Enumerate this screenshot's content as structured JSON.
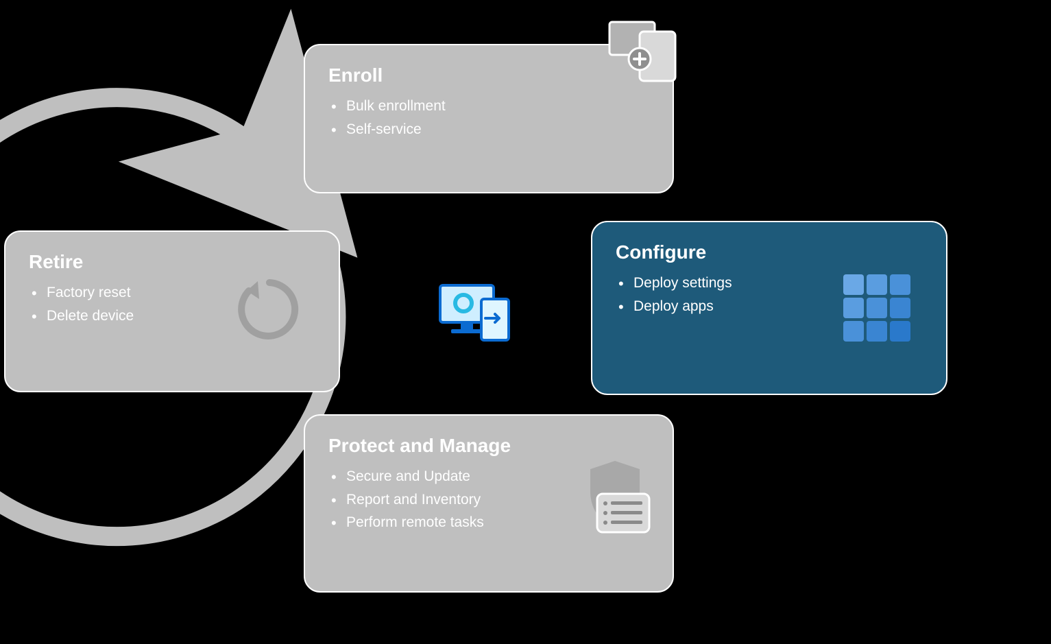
{
  "cycle": {
    "enroll": {
      "title": "Enroll",
      "items": [
        "Bulk enrollment",
        "Self-service"
      ],
      "icon": "devices-add-icon",
      "active": false
    },
    "configure": {
      "title": "Configure",
      "items": [
        "Deploy settings",
        "Deploy apps"
      ],
      "icon": "grid-apps-icon",
      "active": true
    },
    "protect": {
      "title": "Protect and Manage",
      "items": [
        "Secure and Update",
        "Report and Inventory",
        "Perform remote tasks"
      ],
      "icon": "shield-list-icon",
      "active": false
    },
    "retire": {
      "title": "Retire",
      "items": [
        "Factory reset",
        "Delete device"
      ],
      "icon": "reset-cycle-icon",
      "active": false
    }
  },
  "center_icon": "device-management-icon",
  "colors": {
    "inactive_bg": "#bfbfbf",
    "active_bg": "#1e5a7a",
    "arc": "#bfbfbf",
    "grid_tiles": [
      "#6aa8e6",
      "#5a9de0",
      "#4a91d9",
      "#5a9de0",
      "#4a91d9",
      "#3a85d2",
      "#4a91d9",
      "#3a85d2",
      "#2a79cb"
    ],
    "center_blue": "#0b6bd1",
    "center_cyan": "#28b9e3"
  }
}
